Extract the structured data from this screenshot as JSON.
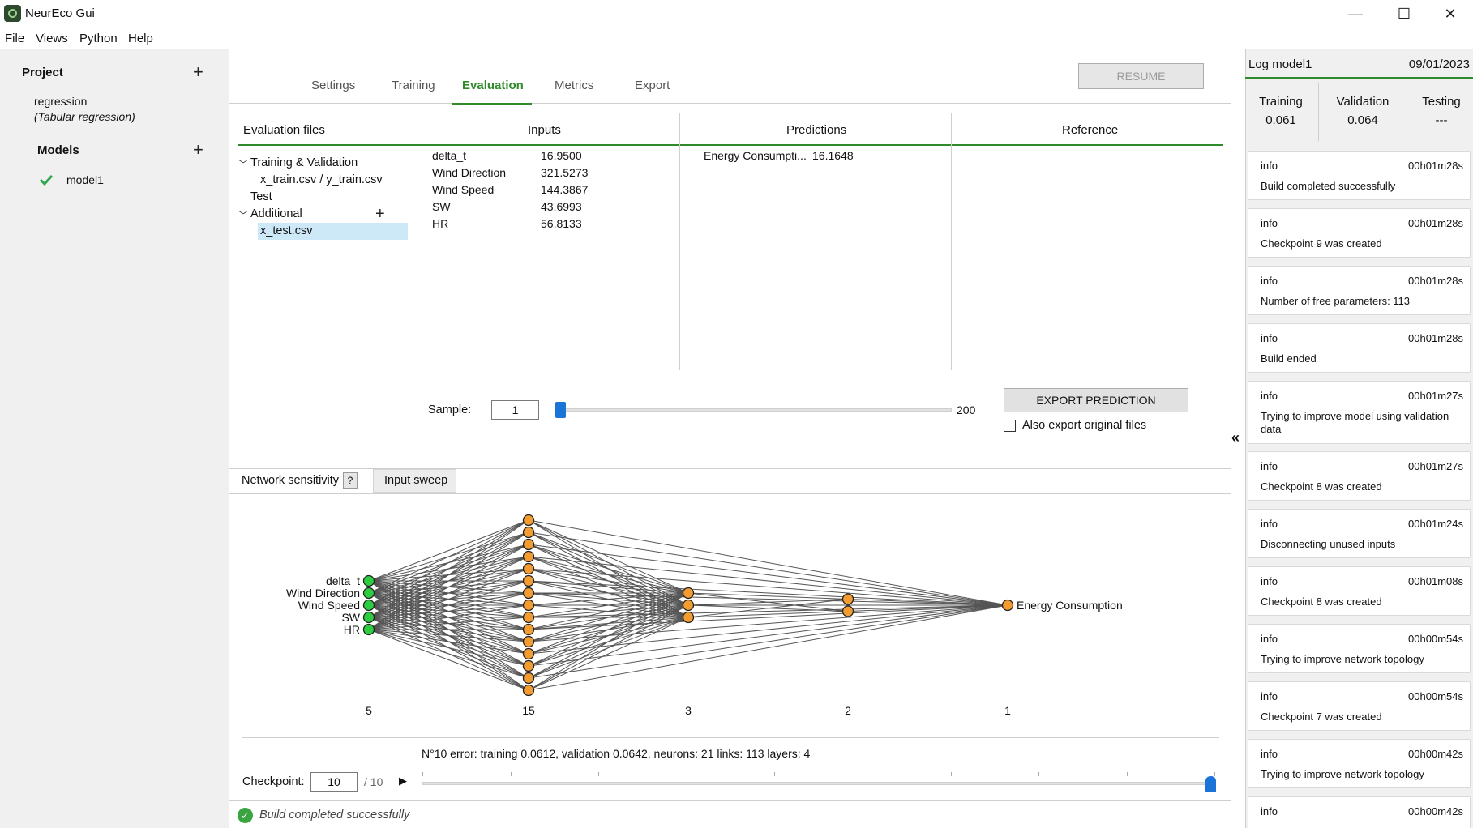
{
  "window": {
    "title": "NeurEco Gui",
    "controls": {
      "minimize": "—",
      "maximize": "☐",
      "close": "✕"
    }
  },
  "menu": [
    "File",
    "Views",
    "Python",
    "Help"
  ],
  "sidebar": {
    "project_heading": "Project",
    "project_name": "regression",
    "project_type": "(Tabular regression)",
    "models_heading": "Models",
    "models": [
      {
        "name": "model1",
        "status_icon": "check-icon"
      }
    ]
  },
  "tabs": [
    "Settings",
    "Training",
    "Evaluation",
    "Metrics",
    "Export"
  ],
  "active_tab": "Evaluation",
  "resume_label": "RESUME",
  "evaluation": {
    "files_header": "Evaluation files",
    "inputs_header": "Inputs",
    "predictions_header": "Predictions",
    "reference_header": "Reference",
    "tree": {
      "train_val": "Training & Validation",
      "train_files": "x_train.csv / y_train.csv",
      "test": "Test",
      "additional": "Additional",
      "selected_file": "x_test.csv"
    },
    "inputs": [
      {
        "name": "delta_t",
        "value": "16.9500"
      },
      {
        "name": "Wind Direction",
        "value": "321.5273"
      },
      {
        "name": "Wind Speed",
        "value": "144.3867"
      },
      {
        "name": "SW",
        "value": "43.6993"
      },
      {
        "name": "HR",
        "value": "56.8133"
      }
    ],
    "predictions": [
      {
        "name": "Energy Consumpti...",
        "value": "16.1648"
      }
    ],
    "sample_label": "Sample:",
    "sample_value": "1",
    "sample_max": "200",
    "sample_position": 0.005,
    "export_label": "EXPORT PREDICTION",
    "also_export_label": "Also export original files",
    "also_export_checked": false
  },
  "subtabs": {
    "sensitivity": "Network sensitivity",
    "help": "?",
    "sweep": "Input sweep"
  },
  "network": {
    "input_labels": [
      "delta_t",
      "Wind Direction",
      "Wind Speed",
      "SW",
      "HR"
    ],
    "output_label": "Energy Consumption",
    "layer_sizes": [
      5,
      15,
      3,
      2,
      1
    ],
    "layer_counts": [
      "5",
      "15",
      "3",
      "2",
      "1"
    ],
    "colors": {
      "input": "#2ecc40",
      "hidden": "#f39c32",
      "link": "#555555"
    },
    "summary": "N°10 error: training 0.0612, validation 0.0642,  neurons: 21  links: 113  layers: 4",
    "checkpoint_label": "Checkpoint:",
    "checkpoint_value": "10",
    "checkpoint_total": "/ 10",
    "play_icon": "▶",
    "checkpoint_position": 1.0
  },
  "status": {
    "icon": "✓",
    "text": "Build completed successfully"
  },
  "collapse_icon": "«",
  "log": {
    "title": "Log model1",
    "date": "09/01/2023",
    "metrics": [
      {
        "label": "Training",
        "value": "0.061"
      },
      {
        "label": "Validation",
        "value": "0.064"
      },
      {
        "label": "Testing",
        "value": "---"
      }
    ],
    "entries": [
      {
        "level": "info",
        "time": "00h01m28s",
        "message": "Build completed successfully"
      },
      {
        "level": "info",
        "time": "00h01m28s",
        "message": "Checkpoint 9 was created"
      },
      {
        "level": "info",
        "time": "00h01m28s",
        "message": "Number of free parameters: 113"
      },
      {
        "level": "info",
        "time": "00h01m28s",
        "message": "Build ended"
      },
      {
        "level": "info",
        "time": "00h01m27s",
        "message": "Trying to improve model using validation data"
      },
      {
        "level": "info",
        "time": "00h01m27s",
        "message": "Checkpoint 8 was created"
      },
      {
        "level": "info",
        "time": "00h01m24s",
        "message": "Disconnecting unused inputs"
      },
      {
        "level": "info",
        "time": "00h01m08s",
        "message": "Checkpoint 8 was created"
      },
      {
        "level": "info",
        "time": "00h00m54s",
        "message": "Trying to improve network topology"
      },
      {
        "level": "info",
        "time": "00h00m54s",
        "message": "Checkpoint 7 was created"
      },
      {
        "level": "info",
        "time": "00h00m42s",
        "message": "Trying to improve network topology"
      },
      {
        "level": "info",
        "time": "00h00m42s",
        "message": ""
      }
    ]
  }
}
